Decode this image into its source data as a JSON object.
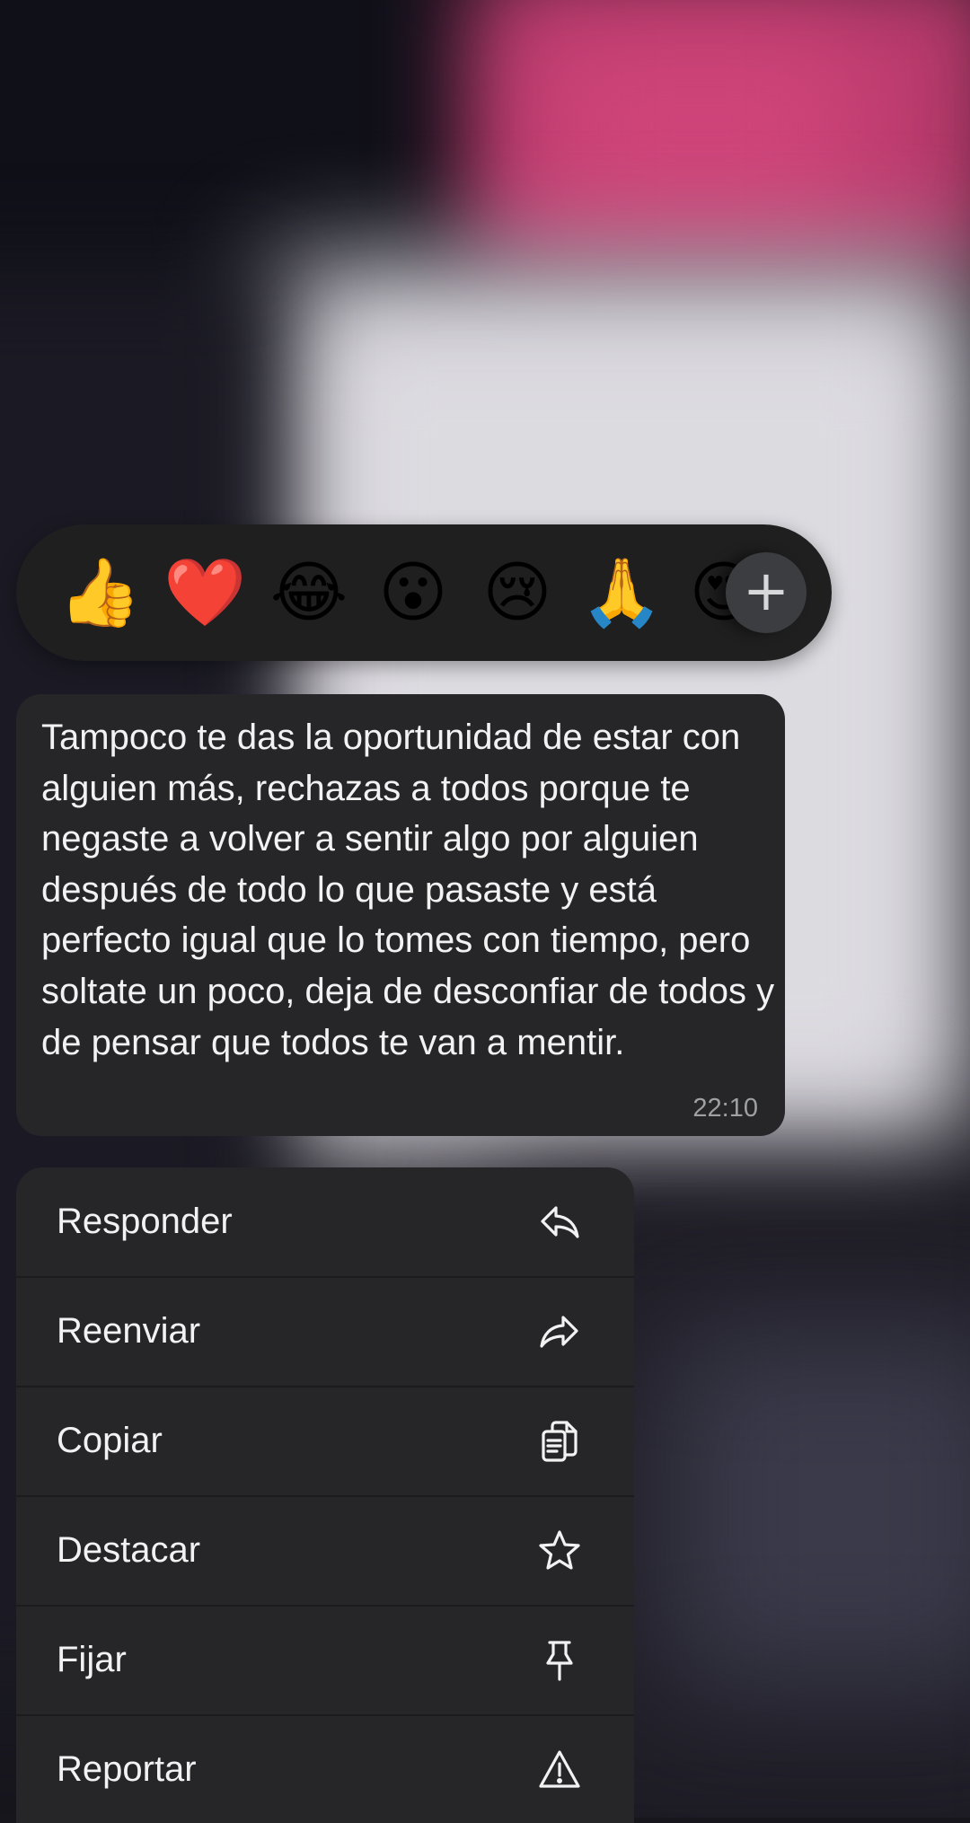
{
  "reactions": {
    "emojis": [
      "👍",
      "❤️",
      "😂",
      "😮",
      "😢",
      "🙏",
      "😍"
    ],
    "more_label": "+"
  },
  "message": {
    "text": "Tampoco te das la oportunidad de estar con alguien más, rechazas a todos porque te negaste a volver a sentir algo por alguien después de todo lo que pasaste y está perfecto igual que lo tomes con tiempo, pero soltate un poco, deja de desconfiar de todos y de pensar que todos te van a mentir.",
    "time": "22:10"
  },
  "menu": {
    "items": [
      {
        "label": "Responder",
        "icon": "reply-icon"
      },
      {
        "label": "Reenviar",
        "icon": "forward-icon"
      },
      {
        "label": "Copiar",
        "icon": "copy-icon"
      },
      {
        "label": "Destacar",
        "icon": "star-icon"
      },
      {
        "label": "Fijar",
        "icon": "pin-icon"
      },
      {
        "label": "Reportar",
        "icon": "warning-icon"
      }
    ]
  },
  "colors": {
    "surface": "#262628",
    "reaction_bar": "#1f1f20",
    "text": "#f2f2f3",
    "timestamp": "#9ea0a4"
  }
}
